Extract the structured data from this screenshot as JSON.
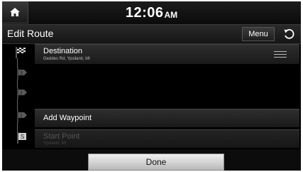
{
  "status_bar": {
    "time": "12:06",
    "ampm": "AM",
    "home_icon": "home-icon"
  },
  "title_bar": {
    "title": "Edit Route",
    "menu_label": "Menu",
    "back_icon": "back-arrow-icon"
  },
  "route": {
    "destination": {
      "label": "Destination",
      "address": "Geddes Rd, Ypsilanti, MI",
      "icon": "checkered-flag-icon"
    },
    "waypoint_flags": [
      "3",
      "2",
      "1"
    ],
    "add_waypoint_label": "Add Waypoint",
    "start": {
      "label": "Start Point",
      "address": "Ypsilanti, MI",
      "flag_label": "S"
    }
  },
  "footer": {
    "done_label": "Done"
  }
}
